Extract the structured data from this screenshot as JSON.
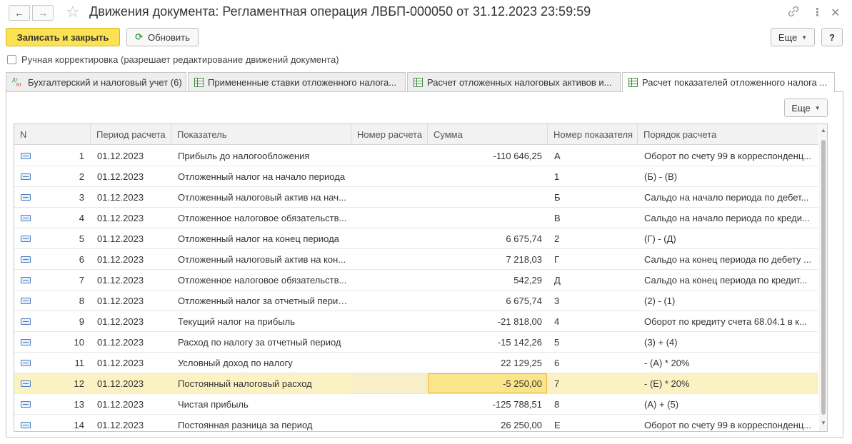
{
  "window": {
    "title": "Движения документа: Регламентная операция ЛВБП-000050 от 31.12.2023 23:59:59"
  },
  "toolbar": {
    "save_close_label": "Записать и закрыть",
    "refresh_label": "Обновить",
    "more_label": "Еще",
    "help_label": "?"
  },
  "manual_edit": {
    "label": "Ручная корректировка (разрешает редактирование движений документа)",
    "checked": false
  },
  "tabs": [
    {
      "label": "Бухгалтерский и налоговый учет (6)",
      "icon": "dt-kt-icon"
    },
    {
      "label": "Примененные ставки отложенного налога...",
      "icon": "register-table-icon"
    },
    {
      "label": "Расчет отложенных налоговых активов и...",
      "icon": "register-table-icon"
    },
    {
      "label": "Расчет показателей отложенного налога ...",
      "icon": "register-table-icon",
      "active": true
    }
  ],
  "panel": {
    "more_label": "Еще"
  },
  "table": {
    "columns": [
      "N",
      "Период расчета",
      "Показатель",
      "Номер расчета",
      "Сумма",
      "Номер показателя",
      "Порядок расчета"
    ],
    "rows": [
      {
        "n": "1",
        "period": "01.12.2023",
        "indicator": "Прибыль до налогообложения",
        "calc_no": "",
        "sum": "-110 646,25",
        "ind_no": "А",
        "order": "Оборот по счету 99 в корреспонденц..."
      },
      {
        "n": "2",
        "period": "01.12.2023",
        "indicator": "Отложенный налог на начало периода",
        "calc_no": "",
        "sum": "",
        "ind_no": "1",
        "order": "(Б) - (В)"
      },
      {
        "n": "3",
        "period": "01.12.2023",
        "indicator": "Отложенный налоговый актив на нач...",
        "calc_no": "",
        "sum": "",
        "ind_no": "Б",
        "order": "Сальдо на начало периода по дебет..."
      },
      {
        "n": "4",
        "period": "01.12.2023",
        "indicator": "Отложенное налоговое обязательств...",
        "calc_no": "",
        "sum": "",
        "ind_no": "В",
        "order": "Сальдо на начало периода по креди..."
      },
      {
        "n": "5",
        "period": "01.12.2023",
        "indicator": "Отложенный налог на конец периода",
        "calc_no": "",
        "sum": "6 675,74",
        "ind_no": "2",
        "order": "(Г) - (Д)"
      },
      {
        "n": "6",
        "period": "01.12.2023",
        "indicator": "Отложенный налоговый актив на кон...",
        "calc_no": "",
        "sum": "7 218,03",
        "ind_no": "Г",
        "order": "Сальдо на конец периода по дебету ..."
      },
      {
        "n": "7",
        "period": "01.12.2023",
        "indicator": "Отложенное налоговое обязательств...",
        "calc_no": "",
        "sum": "542,29",
        "ind_no": "Д",
        "order": "Сальдо на конец периода по кредит..."
      },
      {
        "n": "8",
        "period": "01.12.2023",
        "indicator": "Отложенный налог за отчетный период",
        "calc_no": "",
        "sum": "6 675,74",
        "ind_no": "3",
        "order": "(2) - (1)"
      },
      {
        "n": "9",
        "period": "01.12.2023",
        "indicator": "Текущий налог на прибыль",
        "calc_no": "",
        "sum": "-21 818,00",
        "ind_no": "4",
        "order": "Оборот по кредиту счета 68.04.1 в к..."
      },
      {
        "n": "10",
        "period": "01.12.2023",
        "indicator": "Расход по налогу за отчетный период",
        "calc_no": "",
        "sum": "-15 142,26",
        "ind_no": "5",
        "order": "(3) + (4)"
      },
      {
        "n": "11",
        "period": "01.12.2023",
        "indicator": "Условный доход по налогу",
        "calc_no": "",
        "sum": "22 129,25",
        "ind_no": "6",
        "order": "- (А) * 20%"
      },
      {
        "n": "12",
        "period": "01.12.2023",
        "indicator": "Постоянный налоговый расход",
        "calc_no": "",
        "sum": "-5 250,00",
        "ind_no": "7",
        "order": "- (Е) * 20%",
        "selected": true
      },
      {
        "n": "13",
        "period": "01.12.2023",
        "indicator": "Чистая прибыль",
        "calc_no": "",
        "sum": "-125 788,51",
        "ind_no": "8",
        "order": "(А) + (5)"
      },
      {
        "n": "14",
        "period": "01.12.2023",
        "indicator": "Постоянная разница за период",
        "calc_no": "",
        "sum": "26 250,00",
        "ind_no": "Е",
        "order": "Оборот по счету 99 в корреспонденц..."
      }
    ]
  },
  "colors": {
    "primary_button": "#fbe252",
    "selected_row": "#fbf2c4",
    "selected_cell": "#fbe58a",
    "refresh_icon": "#3ba03b"
  }
}
